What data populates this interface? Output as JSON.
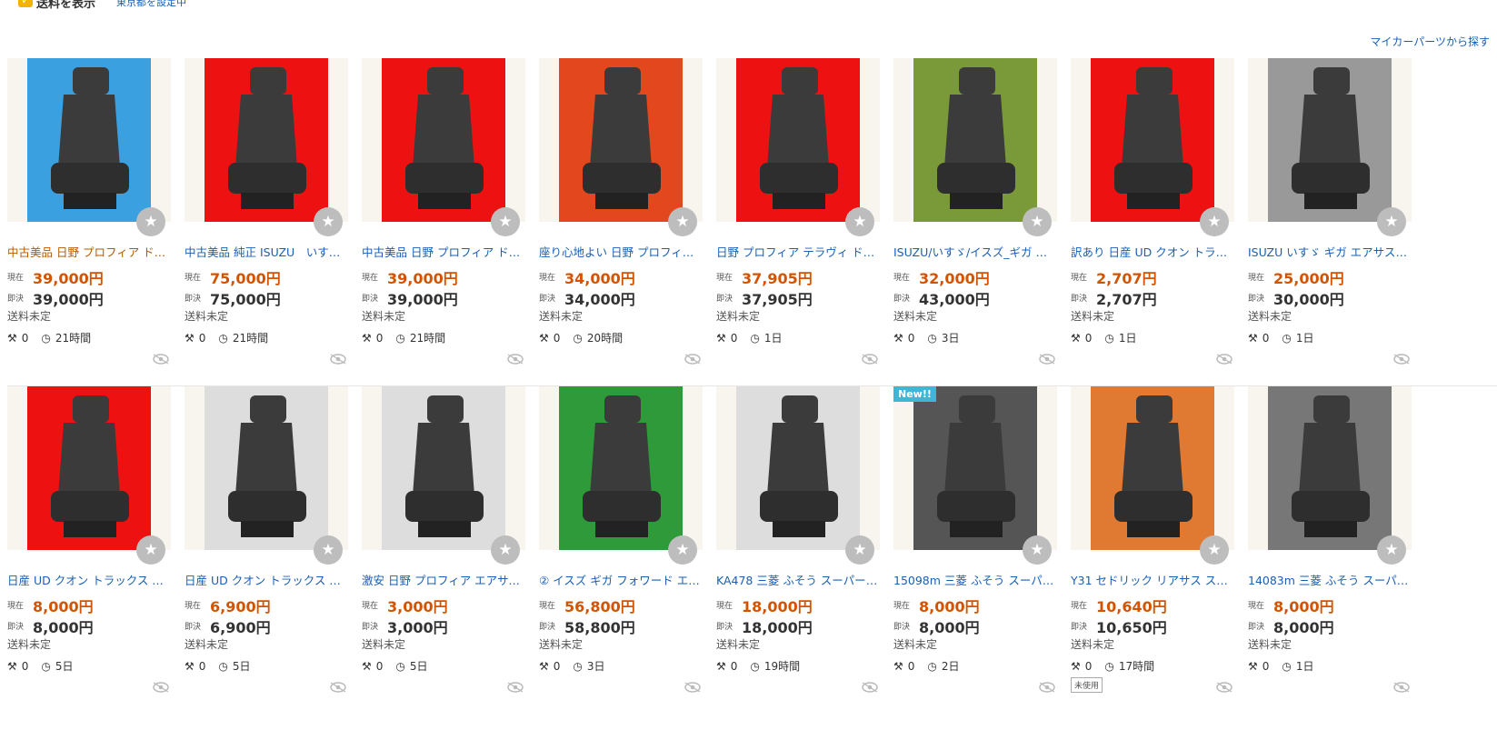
{
  "filter": {
    "shipping_checkbox_label": "送料を表示",
    "location_link": "東京都を設定中"
  },
  "mycar_link": "マイカーパーツから探す",
  "labels": {
    "current": "現在",
    "buyout": "即決"
  },
  "items": [
    {
      "title": "中古美品 日野 プロフィア ドラ…",
      "current": "39,000円",
      "buyout": "39,000円",
      "shipping": "送料未定",
      "bids": "0",
      "time": "21時間",
      "visited": true,
      "bg": "#3aa0e0"
    },
    {
      "title": "中古美品 純正 ISUZU　いすゞ…",
      "current": "75,000円",
      "buyout": "75,000円",
      "shipping": "送料未定",
      "bids": "0",
      "time": "21時間",
      "bg": "#e11"
    },
    {
      "title": "中古美品 日野 プロフィア ドラ…",
      "current": "39,000円",
      "buyout": "39,000円",
      "shipping": "送料未定",
      "bids": "0",
      "time": "21時間",
      "bg": "#e11"
    },
    {
      "title": "座り心地よい 日野 プロフィア …",
      "current": "34,000円",
      "buyout": "34,000円",
      "shipping": "送料未定",
      "bids": "0",
      "time": "20時間",
      "bg": "#e3471d"
    },
    {
      "title": "日野 プロフィア テラヴィ ドラ…",
      "current": "37,905円",
      "buyout": "37,905円",
      "shipping": "送料未定",
      "bids": "0",
      "time": "1日",
      "bg": "#e11"
    },
    {
      "title": "ISUZU/いすゞ/イスズ_ギガ フ…",
      "current": "32,000円",
      "buyout": "43,000円",
      "shipping": "送料未定",
      "bids": "0",
      "time": "3日",
      "bg": "#7a9a3a"
    },
    {
      "title": "訳あり 日産 UD クオン トラッ…",
      "current": "2,707円",
      "buyout": "2,707円",
      "shipping": "送料未定",
      "bids": "0",
      "time": "1日",
      "bg": "#e11"
    },
    {
      "title": "ISUZU いすゞ ギガ エアサス エ…",
      "current": "25,000円",
      "buyout": "30,000円",
      "shipping": "送料未定",
      "bids": "0",
      "time": "1日",
      "bg": "#999"
    },
    {
      "title": "日産 UD クオン トラックス エ…",
      "current": "8,000円",
      "buyout": "8,000円",
      "shipping": "送料未定",
      "bids": "0",
      "time": "5日",
      "bg": "#e11"
    },
    {
      "title": "日産 UD クオン トラックス エ…",
      "current": "6,900円",
      "buyout": "6,900円",
      "shipping": "送料未定",
      "bids": "0",
      "time": "5日",
      "bg": "#ddd"
    },
    {
      "title": "激安 日野 プロフィア エアサス …",
      "current": "3,000円",
      "buyout": "3,000円",
      "shipping": "送料未定",
      "bids": "0",
      "time": "5日",
      "bg": "#ddd"
    },
    {
      "title": "② イスズ ギガ フォワード エア…",
      "current": "56,800円",
      "buyout": "58,800円",
      "shipping": "送料未定",
      "bids": "0",
      "time": "3日",
      "bg": "#2f9a3a"
    },
    {
      "title": "KA478 三菱 ふそう スーパーグ…",
      "current": "18,000円",
      "buyout": "18,000円",
      "shipping": "送料未定",
      "bids": "0",
      "time": "19時間",
      "bg": "#ddd"
    },
    {
      "title": "15098m 三菱 ふそう スーパー…",
      "current": "8,000円",
      "buyout": "8,000円",
      "shipping": "送料未定",
      "bids": "0",
      "time": "2日",
      "new_badge": "New!!",
      "bg": "#555"
    },
    {
      "title": "Y31 セドリック リアサス スプ…",
      "current": "10,640円",
      "buyout": "10,650円",
      "shipping": "送料未定",
      "bids": "0",
      "time": "17時間",
      "unused_tag": "未使用",
      "bg": "#e07a33"
    },
    {
      "title": "14083m 三菱 ふそう スーパー…",
      "current": "8,000円",
      "buyout": "8,000円",
      "shipping": "送料未定",
      "bids": "0",
      "time": "1日",
      "bg": "#777"
    }
  ]
}
